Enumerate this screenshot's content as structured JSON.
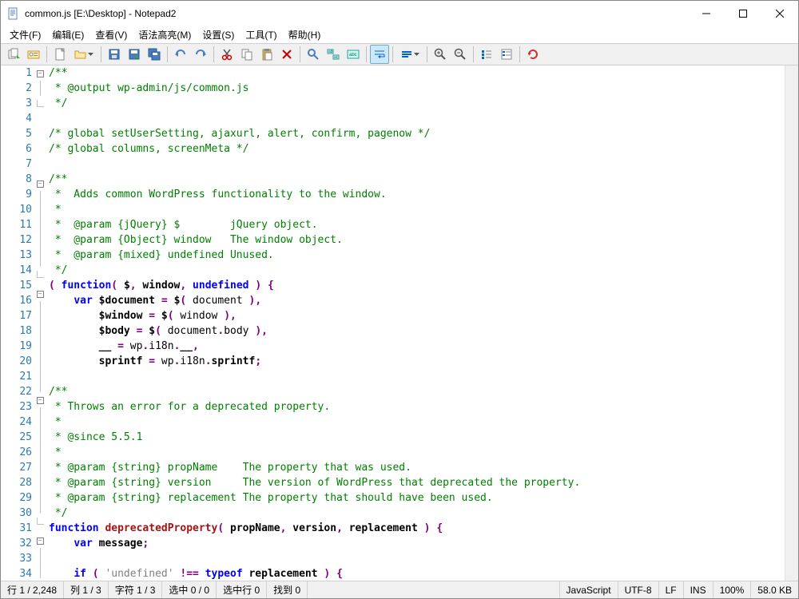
{
  "window": {
    "title": "common.js [E:\\Desktop] - Notepad2"
  },
  "menu": {
    "file": "文件(F)",
    "edit": "编辑(E)",
    "view": "查看(V)",
    "syntax": "语法高亮(M)",
    "settings": "设置(S)",
    "tools": "工具(T)",
    "help": "帮助(H)"
  },
  "status": {
    "line": "行 1 / 2,248",
    "col": "列 1 / 3",
    "char": "字符 1 / 3",
    "sel": "选中 0 / 0",
    "sel_lines": "选中行 0",
    "find": "找到 0",
    "lang": "JavaScript",
    "encoding": "UTF-8",
    "eol": "LF",
    "ovr": "INS",
    "zoom": "100%",
    "size": "58.0 KB"
  },
  "code_lines": [
    {
      "n": 1,
      "fold": "start",
      "html": "<span class='c-comment'>/**</span>"
    },
    {
      "n": 2,
      "fold": "mid",
      "html": "<span class='c-comment'> * @output wp-admin/js/common.js</span>"
    },
    {
      "n": 3,
      "fold": "end",
      "html": "<span class='c-comment'> */</span>"
    },
    {
      "n": 4,
      "fold": "",
      "html": ""
    },
    {
      "n": 5,
      "fold": "",
      "html": "<span class='c-comment'>/* global setUserSetting, ajaxurl, alert, confirm, pagenow */</span>"
    },
    {
      "n": 6,
      "fold": "",
      "html": "<span class='c-comment'>/* global columns, screenMeta */</span>"
    },
    {
      "n": 7,
      "fold": "",
      "html": ""
    },
    {
      "n": 8,
      "fold": "start",
      "html": "<span class='c-comment'>/**</span>"
    },
    {
      "n": 9,
      "fold": "mid",
      "html": "<span class='c-comment'> *  Adds common WordPress functionality to the window.</span>"
    },
    {
      "n": 10,
      "fold": "mid",
      "html": "<span class='c-comment'> *</span>"
    },
    {
      "n": 11,
      "fold": "mid",
      "html": "<span class='c-comment'> *  @param {jQuery} $        jQuery object.</span>"
    },
    {
      "n": 12,
      "fold": "mid",
      "html": "<span class='c-comment'> *  @param {Object} window   The window object.</span>"
    },
    {
      "n": 13,
      "fold": "mid",
      "html": "<span class='c-comment'> *  @param {mixed} undefined Unused.</span>"
    },
    {
      "n": 14,
      "fold": "end",
      "html": "<span class='c-comment'> */</span>"
    },
    {
      "n": 15,
      "fold": "start",
      "html": "<span class='c-op'>(</span> <span class='c-keyword'>function</span><span class='c-op'>(</span> <span class='c-var'>$</span><span class='c-op'>,</span> <span class='c-var'>window</span><span class='c-op'>,</span> <span class='c-keyword'>undefined</span> <span class='c-op'>)</span> <span class='c-op'>{</span>"
    },
    {
      "n": 16,
      "fold": "mid",
      "html": "    <span class='c-keyword'>var</span> <span class='c-var'>$document</span> <span class='c-op'>=</span> <span class='c-var'>$</span><span class='c-op'>(</span> <span class='c-plain'>document</span> <span class='c-op'>),</span>"
    },
    {
      "n": 17,
      "fold": "mid",
      "html": "        <span class='c-var'>$window</span> <span class='c-op'>=</span> <span class='c-var'>$</span><span class='c-op'>(</span> <span class='c-plain'>window</span> <span class='c-op'>),</span>"
    },
    {
      "n": 18,
      "fold": "mid",
      "html": "        <span class='c-var'>$body</span> <span class='c-op'>=</span> <span class='c-var'>$</span><span class='c-op'>(</span> <span class='c-plain'>document</span><span class='c-op'>.</span><span class='c-plain'>body</span> <span class='c-op'>),</span>"
    },
    {
      "n": 19,
      "fold": "mid",
      "html": "        <span class='c-var'>__</span> <span class='c-op'>=</span> <span class='c-plain'>wp</span><span class='c-op'>.</span><span class='c-plain'>i18n</span><span class='c-op'>.</span><span class='c-var'>__</span><span class='c-op'>,</span>"
    },
    {
      "n": 20,
      "fold": "mid",
      "html": "        <span class='c-var'>sprintf</span> <span class='c-op'>=</span> <span class='c-plain'>wp</span><span class='c-op'>.</span><span class='c-plain'>i18n</span><span class='c-op'>.</span><span class='c-var'>sprintf</span><span class='c-op'>;</span>"
    },
    {
      "n": 21,
      "fold": "mid",
      "html": ""
    },
    {
      "n": 22,
      "fold": "start",
      "html": "<span class='c-comment'>/**</span>"
    },
    {
      "n": 23,
      "fold": "mid",
      "html": "<span class='c-comment'> * Throws an error for a deprecated property.</span>"
    },
    {
      "n": 24,
      "fold": "mid",
      "html": "<span class='c-comment'> *</span>"
    },
    {
      "n": 25,
      "fold": "mid",
      "html": "<span class='c-comment'> * @since 5.5.1</span>"
    },
    {
      "n": 26,
      "fold": "mid",
      "html": "<span class='c-comment'> *</span>"
    },
    {
      "n": 27,
      "fold": "mid",
      "html": "<span class='c-comment'> * @param {string} propName    The property that was used.</span>"
    },
    {
      "n": 28,
      "fold": "mid",
      "html": "<span class='c-comment'> * @param {string} version     The version of WordPress that deprecated the property.</span>"
    },
    {
      "n": 29,
      "fold": "mid",
      "html": "<span class='c-comment'> * @param {string} replacement The property that should have been used.</span>"
    },
    {
      "n": 30,
      "fold": "end",
      "html": "<span class='c-comment'> */</span>"
    },
    {
      "n": 31,
      "fold": "start",
      "html": "<span class='c-keyword'>function</span> <span class='c-func'>deprecatedProperty</span><span class='c-op'>(</span> <span class='c-var'>propName</span><span class='c-op'>,</span> <span class='c-var'>version</span><span class='c-op'>,</span> <span class='c-var'>replacement</span> <span class='c-op'>)</span> <span class='c-op'>{</span>"
    },
    {
      "n": 32,
      "fold": "mid",
      "html": "    <span class='c-keyword'>var</span> <span class='c-var'>message</span><span class='c-op'>;</span>"
    },
    {
      "n": 33,
      "fold": "mid",
      "html": ""
    },
    {
      "n": 34,
      "fold": "start",
      "html": "    <span class='c-keyword'>if</span> <span class='c-op'>(</span> <span class='c-string'>'undefined'</span> <span class='c-op'>!==</span> <span class='c-keyword'>typeof</span> <span class='c-var'>replacement</span> <span class='c-op'>)</span> <span class='c-op'>{</span>"
    }
  ]
}
